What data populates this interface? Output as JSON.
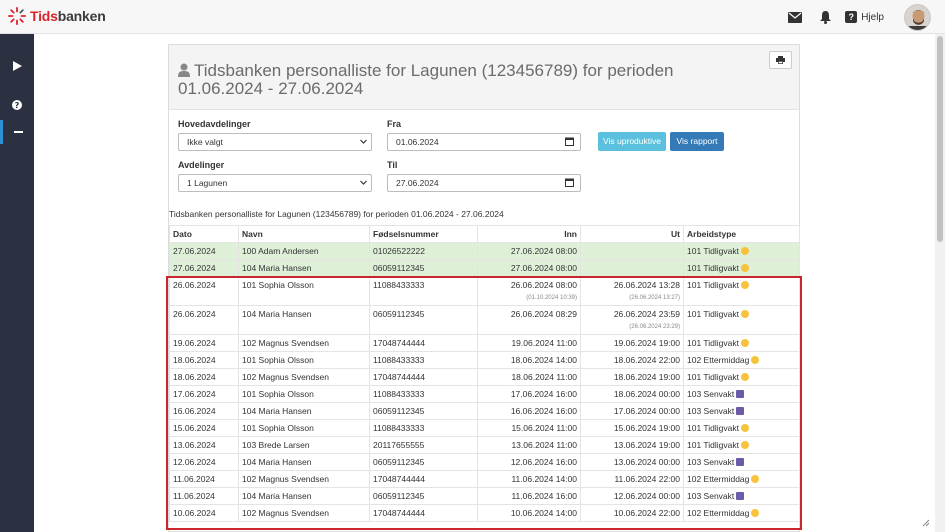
{
  "brand": {
    "name_red": "Tids",
    "name_dark": "banken"
  },
  "header": {
    "help_label": "Hjelp",
    "mail_icon": "mail-icon",
    "bell_icon": "bell-icon"
  },
  "page": {
    "title": "Tidsbanken personalliste for Lagunen (123456789) for perioden 01.06.2024 - 27.06.2024"
  },
  "filters": {
    "hovedavdelinger_label": "Hovedavdelinger",
    "hovedavdelinger_value": "Ikke valgt",
    "fra_label": "Fra",
    "fra_value": "01.06.2024",
    "avdelinger_label": "Avdelinger",
    "avdelinger_value": "1 Lagunen",
    "til_label": "Til",
    "til_value": "27.06.2024",
    "btn_uproduktive": "Vis uproduktive",
    "btn_rapport": "Vis rapport"
  },
  "report": {
    "caption": "Tidsbanken personalliste for Lagunen (123456789) for perioden 01.06.2024 - 27.06.2024",
    "columns": {
      "dato": "Dato",
      "navn": "Navn",
      "fodselsnummer": "Fødselsnummer",
      "inn": "Inn",
      "ut": "Ut",
      "arbeidstype": "Arbeidstype"
    },
    "rows": [
      {
        "dato": "27.06.2024",
        "navn": "100 Adam Andersen",
        "fnr": "01026522222",
        "inn": "27.06.2024 08:00",
        "inn_sub": "",
        "ut": "",
        "ut_sub": "",
        "type": "101 Tidligvakt",
        "icon": "sun",
        "green": true
      },
      {
        "dato": "27.06.2024",
        "navn": "104 Maria Hansen",
        "fnr": "06059112345",
        "inn": "27.06.2024 08:00",
        "inn_sub": "",
        "ut": "",
        "ut_sub": "",
        "type": "101 Tidligvakt",
        "icon": "sun",
        "green": true
      },
      {
        "dato": "26.06.2024",
        "navn": "101 Sophia Olsson",
        "fnr": "11088433333",
        "inn": "26.06.2024 08:00",
        "inn_sub": "(01.10.2024 10:39)",
        "ut": "26.06.2024 13:28",
        "ut_sub": "(26.06.2024 13:27)",
        "type": "101 Tidligvakt",
        "icon": "sun",
        "green": false
      },
      {
        "dato": "26.06.2024",
        "navn": "104 Maria Hansen",
        "fnr": "06059112345",
        "inn": "26.06.2024 08:29",
        "inn_sub": "",
        "ut": "26.06.2024 23:59",
        "ut_sub": "(26.06.2024 23:29)",
        "type": "101 Tidligvakt",
        "icon": "sun",
        "green": false
      },
      {
        "dato": "19.06.2024",
        "navn": "102 Magnus Svendsen",
        "fnr": "17048744444",
        "inn": "19.06.2024 11:00",
        "inn_sub": "",
        "ut": "19.06.2024 19:00",
        "ut_sub": "",
        "type": "101 Tidligvakt",
        "icon": "sun",
        "green": false
      },
      {
        "dato": "18.06.2024",
        "navn": "101 Sophia Olsson",
        "fnr": "11088433333",
        "inn": "18.06.2024 14:00",
        "inn_sub": "",
        "ut": "18.06.2024 22:00",
        "ut_sub": "",
        "type": "102 Ettermiddag",
        "icon": "sun",
        "green": false
      },
      {
        "dato": "18.06.2024",
        "navn": "102 Magnus Svendsen",
        "fnr": "17048744444",
        "inn": "18.06.2024 11:00",
        "inn_sub": "",
        "ut": "18.06.2024 19:00",
        "ut_sub": "",
        "type": "101 Tidligvakt",
        "icon": "sun",
        "green": false
      },
      {
        "dato": "17.06.2024",
        "navn": "101 Sophia Olsson",
        "fnr": "11088433333",
        "inn": "17.06.2024 16:00",
        "inn_sub": "",
        "ut": "18.06.2024 00:00",
        "ut_sub": "",
        "type": "103 Senvakt",
        "icon": "moon",
        "green": false
      },
      {
        "dato": "16.06.2024",
        "navn": "104 Maria Hansen",
        "fnr": "06059112345",
        "inn": "16.06.2024 16:00",
        "inn_sub": "",
        "ut": "17.06.2024 00:00",
        "ut_sub": "",
        "type": "103 Senvakt",
        "icon": "moon",
        "green": false
      },
      {
        "dato": "15.06.2024",
        "navn": "101 Sophia Olsson",
        "fnr": "11088433333",
        "inn": "15.06.2024 11:00",
        "inn_sub": "",
        "ut": "15.06.2024 19:00",
        "ut_sub": "",
        "type": "101 Tidligvakt",
        "icon": "sun",
        "green": false
      },
      {
        "dato": "13.06.2024",
        "navn": "103 Brede Larsen",
        "fnr": "20117655555",
        "inn": "13.06.2024 11:00",
        "inn_sub": "",
        "ut": "13.06.2024 19:00",
        "ut_sub": "",
        "type": "101 Tidligvakt",
        "icon": "sun",
        "green": false
      },
      {
        "dato": "12.06.2024",
        "navn": "104 Maria Hansen",
        "fnr": "06059112345",
        "inn": "12.06.2024 16:00",
        "inn_sub": "",
        "ut": "13.06.2024 00:00",
        "ut_sub": "",
        "type": "103 Senvakt",
        "icon": "moon",
        "green": false
      },
      {
        "dato": "11.06.2024",
        "navn": "102 Magnus Svendsen",
        "fnr": "17048744444",
        "inn": "11.06.2024 14:00",
        "inn_sub": "",
        "ut": "11.06.2024 22:00",
        "ut_sub": "",
        "type": "102 Ettermiddag",
        "icon": "sun",
        "green": false
      },
      {
        "dato": "11.06.2024",
        "navn": "104 Maria Hansen",
        "fnr": "06059112345",
        "inn": "11.06.2024 16:00",
        "inn_sub": "",
        "ut": "12.06.2024 00:00",
        "ut_sub": "",
        "type": "103 Senvakt",
        "icon": "moon",
        "green": false
      },
      {
        "dato": "10.06.2024",
        "navn": "102 Magnus Svendsen",
        "fnr": "17048744444",
        "inn": "10.06.2024 14:00",
        "inn_sub": "",
        "ut": "10.06.2024 22:00",
        "ut_sub": "",
        "type": "102 Ettermiddag",
        "icon": "sun",
        "green": false
      }
    ]
  },
  "colors": {
    "accent": "#337ab7",
    "info": "#5bc0de",
    "highlight": "#c9262e",
    "sidebar": "#2c3142",
    "row_green": "#dff0d8"
  }
}
